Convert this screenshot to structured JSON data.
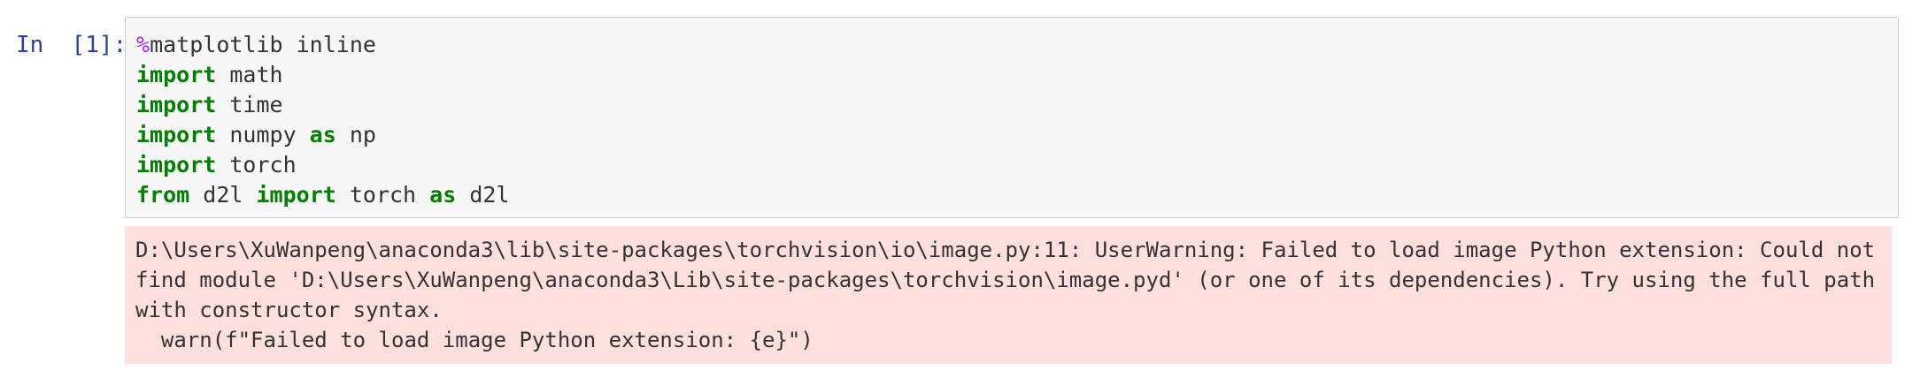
{
  "cell": {
    "prompt": "In  [1]:",
    "code": [
      [
        {
          "t": "%",
          "c": "magic"
        },
        {
          "t": "matplotlib inline",
          "c": ""
        }
      ],
      [
        {
          "t": "import",
          "c": "kw"
        },
        {
          "t": " math",
          "c": ""
        }
      ],
      [
        {
          "t": "import",
          "c": "kw"
        },
        {
          "t": " time",
          "c": ""
        }
      ],
      [
        {
          "t": "import",
          "c": "kw"
        },
        {
          "t": " numpy ",
          "c": ""
        },
        {
          "t": "as",
          "c": "kw"
        },
        {
          "t": " np",
          "c": ""
        }
      ],
      [
        {
          "t": "import",
          "c": "kw"
        },
        {
          "t": " torch",
          "c": ""
        }
      ],
      [
        {
          "t": "from",
          "c": "kw"
        },
        {
          "t": " d2l ",
          "c": ""
        },
        {
          "t": "import",
          "c": "kw"
        },
        {
          "t": " torch ",
          "c": ""
        },
        {
          "t": "as",
          "c": "kw"
        },
        {
          "t": " d2l",
          "c": ""
        }
      ]
    ],
    "stderr": "D:\\Users\\XuWanpeng\\anaconda3\\lib\\site-packages\\torchvision\\io\\image.py:11: UserWarning: Failed to load image Python extension: Could not find module 'D:\\Users\\XuWanpeng\\anaconda3\\Lib\\site-packages\\torchvision\\image.pyd' (or one of its dependencies). Try using the full path with constructor syntax.\n  warn(f\"Failed to load image Python extension: {e}\")"
  },
  "colors": {
    "prompt": "#303f9f",
    "keyword": "#008000",
    "magic": "#aa22ff",
    "input_bg": "#f7f7f7",
    "stderr_bg": "#fddfdd"
  }
}
